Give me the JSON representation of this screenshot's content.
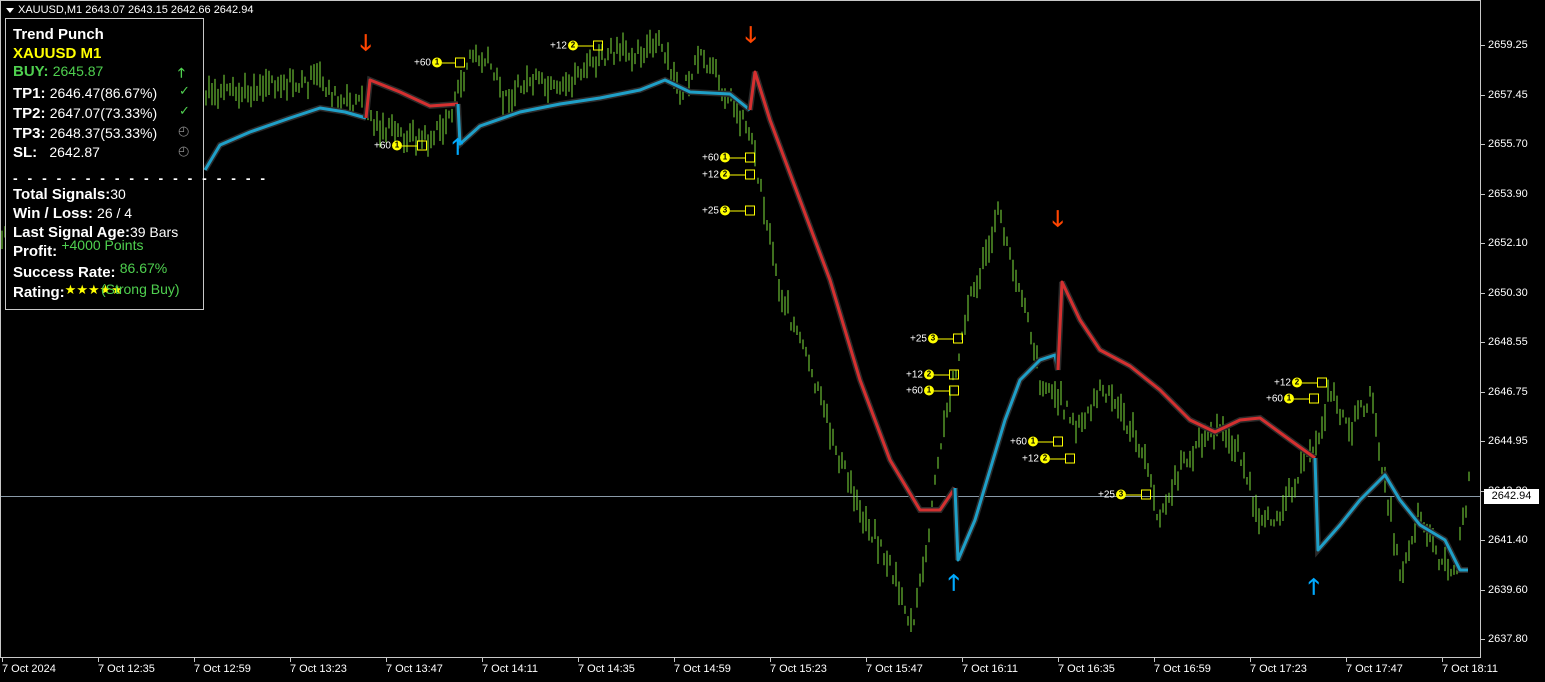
{
  "window": {
    "symbol_line": "XAUUSD,M1  2643.07 2643.15 2642.66 2642.94"
  },
  "panel": {
    "title": "Trend Punch",
    "symbol": "XAUUSD M1",
    "buy_label": "BUY:",
    "buy_value": "2645.87",
    "tp1_label": "TP1:",
    "tp1_value": "2646.47(86.67%)",
    "tp2_label": "TP2:",
    "tp2_value": "2647.07(73.33%)",
    "tp3_label": "TP3:",
    "tp3_value": "2648.37(53.33%)",
    "sl_label": "SL:",
    "sl_value": "2642.87",
    "separator": "- - - - - - - - - - - - - - - - - -",
    "total_label": "Total Signals:",
    "total_value": "30",
    "winloss_label": "Win / Loss:",
    "winloss_value": "26 / 4",
    "age_label": "Last Signal Age:",
    "age_value": "39 Bars",
    "profit_label": "Profit:",
    "profit_value": "+4000 Points",
    "success_label": "Success Rate:",
    "success_value": "86.67%",
    "rating_label": "Rating:",
    "rating_stars": "★★★★★",
    "rating_text": "(Strong Buy)",
    "icons": [
      "up-arrow-icon",
      "check-icon",
      "check-icon",
      "clock-icon",
      "clock-icon"
    ],
    "colors": {
      "green": "#4fd04f",
      "yellow": "#ffff00"
    }
  },
  "price_axis": {
    "labels": [
      "2659.25",
      "2657.45",
      "2655.70",
      "2653.90",
      "2652.10",
      "2650.30",
      "2648.55",
      "2646.75",
      "2644.95",
      "2643.20",
      "2641.40",
      "2639.60",
      "2637.80"
    ],
    "current_price": "2642.94"
  },
  "time_axis": {
    "labels": [
      "7 Oct 2024",
      "7 Oct 12:35",
      "7 Oct 12:59",
      "7 Oct 13:23",
      "7 Oct 13:47",
      "7 Oct 14:11",
      "7 Oct 14:35",
      "7 Oct 14:59",
      "7 Oct 15:23",
      "7 Oct 15:47",
      "7 Oct 16:11",
      "7 Oct 16:35",
      "7 Oct 16:59",
      "7 Oct 17:23",
      "7 Oct 17:47",
      "7 Oct 18:11"
    ]
  },
  "tp_markers": [
    {
      "text": "+60",
      "n": "1"
    },
    {
      "text": "+12",
      "n": "2"
    },
    {
      "text": "+60",
      "n": "1"
    },
    {
      "text": "+60",
      "n": "1"
    },
    {
      "text": "+12",
      "n": "2"
    },
    {
      "text": "+25",
      "n": "3"
    },
    {
      "text": "+25",
      "n": "3"
    },
    {
      "text": "+12",
      "n": "2"
    },
    {
      "text": "+60",
      "n": "1"
    },
    {
      "text": "+60",
      "n": "1"
    },
    {
      "text": "+12",
      "n": "2"
    },
    {
      "text": "+25",
      "n": "3"
    },
    {
      "text": "+12",
      "n": "2"
    },
    {
      "text": "+60",
      "n": "1"
    }
  ],
  "signals": [
    "sell-arrow-icon",
    "buy-arrow-icon",
    "sell-arrow-icon",
    "sell-arrow-icon",
    "buy-arrow-icon",
    "buy-arrow-icon"
  ],
  "colors": {
    "candles": "#7ee03c",
    "trend_up": "#1fa0c8",
    "trend_down": "#d43030",
    "sell_arrow": "#ff4500",
    "buy_arrow": "#00aaff"
  }
}
